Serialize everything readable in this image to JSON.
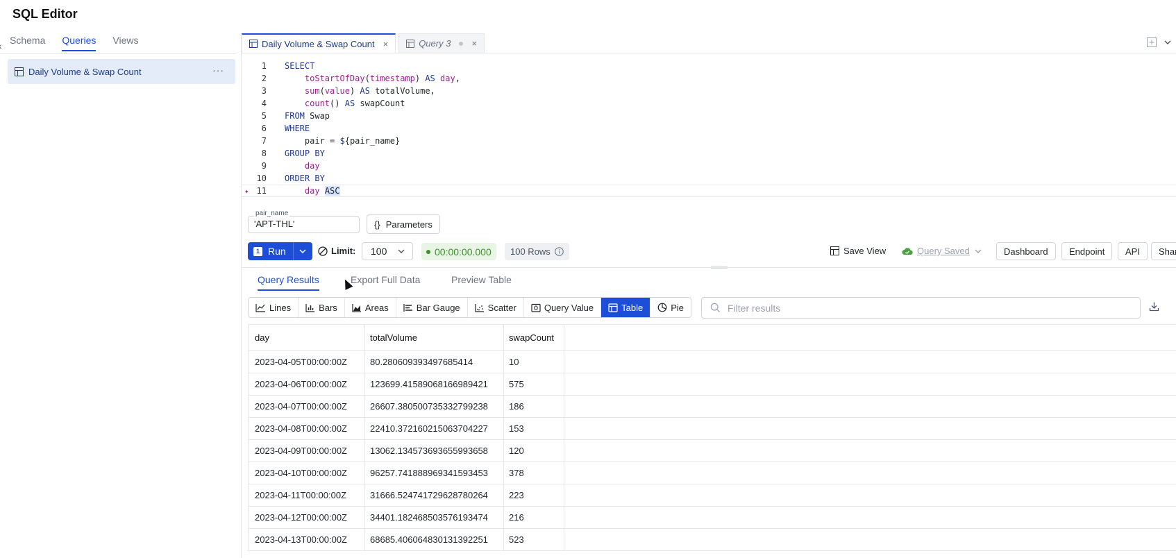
{
  "app": {
    "title": "SQL Editor"
  },
  "left_panel": {
    "tabs": [
      "Schema",
      "Queries",
      "Views"
    ],
    "active_tab": "Queries",
    "items": [
      {
        "label": "Daily Volume & Swap Count",
        "icon": "table-icon",
        "more": "···"
      }
    ]
  },
  "editor_tabs": [
    {
      "label": "Daily Volume & Swap Count",
      "active": true,
      "close": "×"
    },
    {
      "label": "Query 3",
      "active": false,
      "close": "×"
    }
  ],
  "code": {
    "lines": [
      {
        "n": "1",
        "tokens": [
          [
            "kw",
            "SELECT"
          ]
        ]
      },
      {
        "n": "2",
        "tokens": [
          [
            "",
            "    "
          ],
          [
            "fn",
            "toStartOfDay"
          ],
          [
            "",
            "("
          ],
          [
            "fn",
            "timestamp"
          ],
          [
            "",
            ") "
          ],
          [
            "kw",
            "AS"
          ],
          [
            "",
            ""
          ],
          [
            "fn",
            " day"
          ],
          [
            "",
            ","
          ]
        ]
      },
      {
        "n": "3",
        "tokens": [
          [
            "",
            "    "
          ],
          [
            "fn",
            "sum"
          ],
          [
            "",
            "("
          ],
          [
            "fn",
            "value"
          ],
          [
            "",
            ") "
          ],
          [
            "kw",
            "AS"
          ],
          [
            "",
            " totalVolume,"
          ]
        ]
      },
      {
        "n": "4",
        "tokens": [
          [
            "",
            "    "
          ],
          [
            "fn",
            "count"
          ],
          [
            "",
            "() "
          ],
          [
            "kw",
            "AS"
          ],
          [
            "",
            " swapCount"
          ]
        ]
      },
      {
        "n": "5",
        "tokens": [
          [
            "kw",
            "FROM"
          ],
          [
            "",
            " Swap"
          ]
        ]
      },
      {
        "n": "6",
        "tokens": [
          [
            "kw",
            "WHERE"
          ]
        ]
      },
      {
        "n": "7",
        "tokens": [
          [
            "",
            "    pair = "
          ],
          [
            "kw",
            "$"
          ],
          [
            "",
            "{pair_name}"
          ]
        ]
      },
      {
        "n": "8",
        "tokens": [
          [
            "kw",
            "GROUP BY"
          ]
        ]
      },
      {
        "n": "9",
        "tokens": [
          [
            "",
            "    "
          ],
          [
            "fn",
            "day"
          ]
        ]
      },
      {
        "n": "10",
        "tokens": [
          [
            "kw",
            "ORDER BY"
          ]
        ]
      },
      {
        "n": "11",
        "tokens": [
          [
            "",
            "    "
          ],
          [
            "fn",
            "day"
          ],
          [
            "",
            " "
          ],
          [
            "sel",
            "ASC"
          ]
        ]
      }
    ]
  },
  "parameters": {
    "field_label": "pair_name",
    "field_value": "'APT-THL'",
    "button_label": "Parameters",
    "button_icon": "{}"
  },
  "toolbar": {
    "run_label": "Run",
    "run_kbd": "1",
    "limit_label": "Limit:",
    "limit_value": "100",
    "timer": "00:00:00.000",
    "rows": "100 Rows",
    "save_view": "Save View",
    "query_saved": "Query Saved",
    "actions": [
      "Dashboard",
      "Endpoint",
      "API",
      "Shar"
    ]
  },
  "results_tabs": [
    "Query Results",
    "Export Full Data",
    "Preview Table"
  ],
  "viz_types": [
    "Lines",
    "Bars",
    "Areas",
    "Bar Gauge",
    "Scatter",
    "Query Value",
    "Table",
    "Pie"
  ],
  "active_viz": "Table",
  "filter_placeholder": "Filter results",
  "table": {
    "columns": [
      "day",
      "totalVolume",
      "swapCount"
    ],
    "rows": [
      [
        "2023-04-05T00:00:00Z",
        "80.280609393497685414",
        "10"
      ],
      [
        "2023-04-06T00:00:00Z",
        "123699.41589068166989421",
        "575"
      ],
      [
        "2023-04-07T00:00:00Z",
        "26607.380500735332799238",
        "186"
      ],
      [
        "2023-04-08T00:00:00Z",
        "22410.372160215063704227",
        "153"
      ],
      [
        "2023-04-09T00:00:00Z",
        "13062.134573693655993658",
        "120"
      ],
      [
        "2023-04-10T00:00:00Z",
        "96257.741888969341593453",
        "378"
      ],
      [
        "2023-04-11T00:00:00Z",
        "31666.524741729628780264",
        "223"
      ],
      [
        "2023-04-12T00:00:00Z",
        "34401.182468503576193474",
        "216"
      ],
      [
        "2023-04-13T00:00:00Z",
        "68685.406064830131392251",
        "523"
      ]
    ]
  },
  "colors": {
    "accent": "#1d4ed8",
    "success": "#3f8f2b",
    "keyword": "#1e3a8a",
    "function": "#9b1f8e"
  }
}
